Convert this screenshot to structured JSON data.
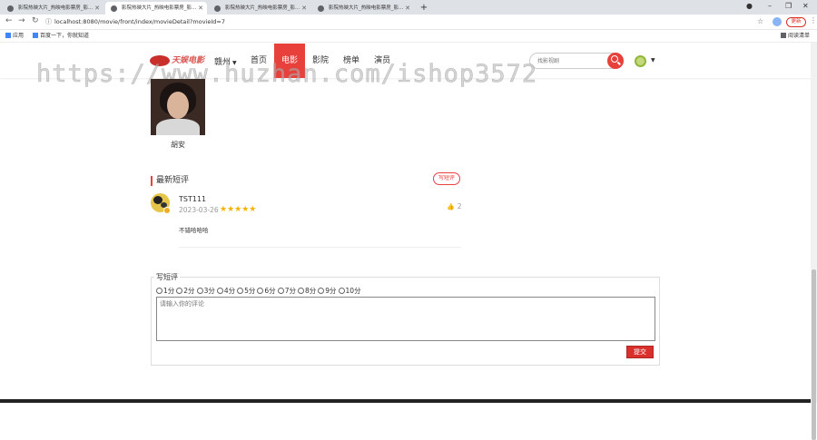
{
  "browser": {
    "tabs": [
      {
        "title": "影院热映大片_热映电影票房_影..."
      },
      {
        "title": "影院热映大片_热映电影票房_影..."
      },
      {
        "title": "影院热映大片_热映电影票房_影..."
      },
      {
        "title": "影院热映大片_热映电影票房_影..."
      }
    ],
    "new_tab": "+",
    "url": "localhost:8080/movie/front/index/movieDetail?movieId=7",
    "update_label": "更新",
    "bookmarks": {
      "apps": "应用",
      "baidu": "百度一下，你就知道",
      "reading_list": "阅读清单"
    }
  },
  "site": {
    "logo_text": "天娱电影",
    "city": "赣州",
    "nav": [
      {
        "label": "首页",
        "active": false
      },
      {
        "label": "电影",
        "active": true
      },
      {
        "label": "影院",
        "active": false
      },
      {
        "label": "榜单",
        "active": false
      },
      {
        "label": "演员",
        "active": false
      }
    ],
    "search_placeholder": "找影视剧"
  },
  "watermark": "https://www.huzhan.com/ishop3572",
  "actor": {
    "name": "胡安"
  },
  "reviews": {
    "title": "最新短评",
    "write_label": "写短评",
    "items": [
      {
        "user": "TST111",
        "date": "2023-03-26",
        "stars": "★★★★★",
        "rating": 5,
        "likes": "2",
        "text": "不错哈哈哈"
      }
    ]
  },
  "form": {
    "legend": "写短评",
    "options": [
      "1分",
      "2分",
      "3分",
      "4分",
      "5分",
      "6分",
      "7分",
      "8分",
      "9分",
      "10分"
    ],
    "placeholder": "请输入你的评论",
    "submit_label": "提交"
  },
  "colors": {
    "accent": "#e8403b",
    "star": "#f5b301"
  }
}
